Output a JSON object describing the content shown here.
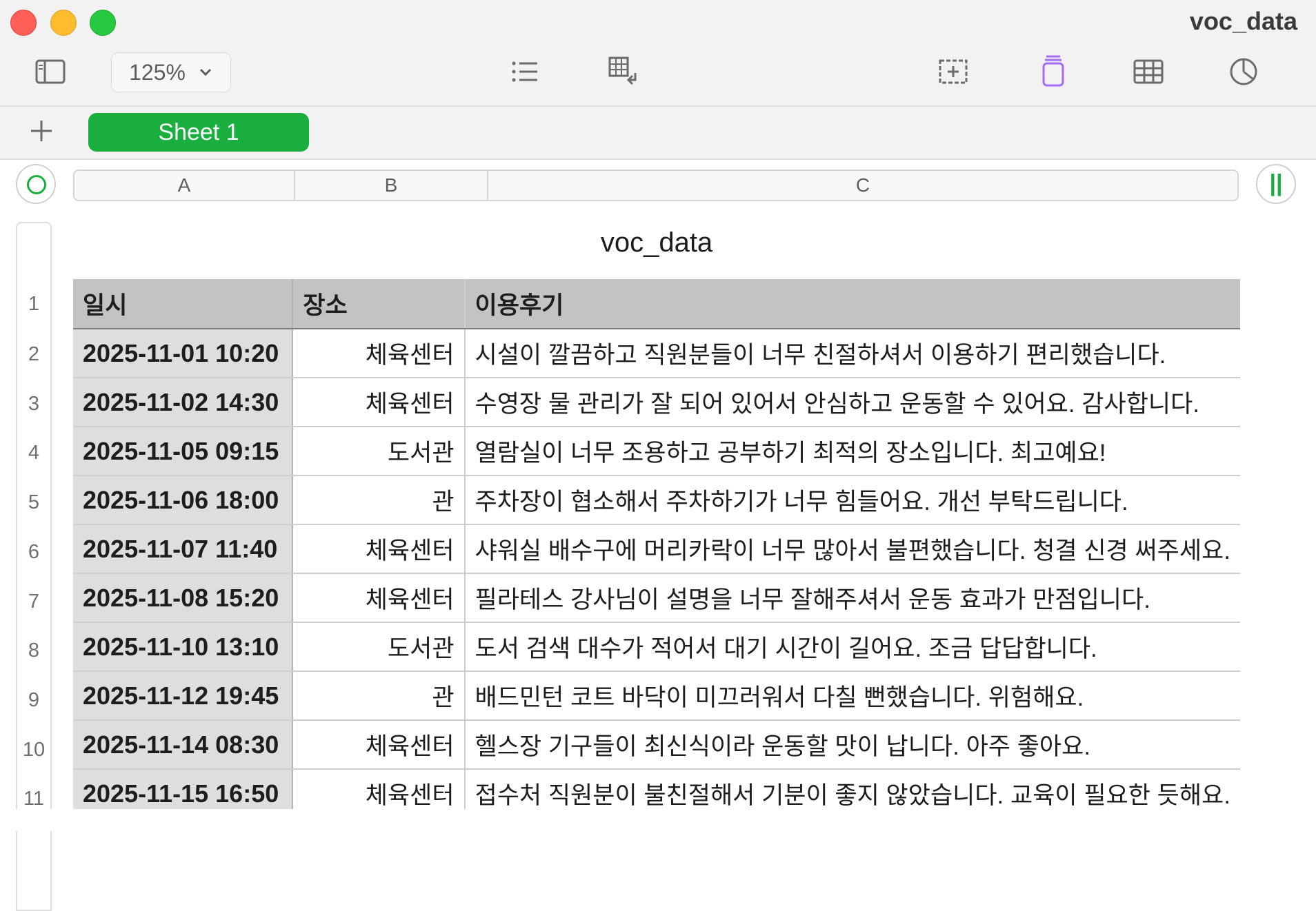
{
  "window": {
    "title": "voc_data"
  },
  "toolbar": {
    "zoom": "125%",
    "icons": [
      "sidebar-icon",
      "list-icon",
      "table-arrange-icon",
      "insert-shape-icon",
      "text-box-icon",
      "table-icon",
      "chart-icon"
    ]
  },
  "tabs": {
    "sheet1": "Sheet 1"
  },
  "columns": [
    "A",
    "B",
    "C"
  ],
  "table": {
    "title": "voc_data",
    "headers": [
      "일시",
      "장소",
      "이용후기"
    ],
    "rows": [
      {
        "num": "2",
        "a": "2025-11-01 10:20",
        "b": "체육센터",
        "c": "시설이 깔끔하고 직원분들이 너무 친절하셔서 이용하기 편리했습니다."
      },
      {
        "num": "3",
        "a": "2025-11-02 14:30",
        "b": "체육센터",
        "c": "수영장 물 관리가 잘 되어 있어서 안심하고 운동할 수 있어요. 감사합니다."
      },
      {
        "num": "4",
        "a": "2025-11-05 09:15",
        "b": "도서관",
        "c": "열람실이 너무 조용하고 공부하기 최적의 장소입니다. 최고예요!"
      },
      {
        "num": "5",
        "a": "2025-11-06 18:00",
        "b": "관",
        "c": "주차장이 협소해서 주차하기가 너무 힘들어요. 개선 부탁드립니다."
      },
      {
        "num": "6",
        "a": "2025-11-07 11:40",
        "b": "체육센터",
        "c": "샤워실 배수구에 머리카락이 너무 많아서 불편했습니다. 청결 신경 써주세요."
      },
      {
        "num": "7",
        "a": "2025-11-08 15:20",
        "b": "체육센터",
        "c": "필라테스 강사님이 설명을 너무 잘해주셔서 운동 효과가 만점입니다."
      },
      {
        "num": "8",
        "a": "2025-11-10 13:10",
        "b": "도서관",
        "c": "도서 검색 대수가 적어서 대기 시간이 길어요. 조금 답답합니다."
      },
      {
        "num": "9",
        "a": "2025-11-12 19:45",
        "b": "관",
        "c": "배드민턴 코트 바닥이 미끄러워서 다칠 뻔했습니다. 위험해요."
      },
      {
        "num": "10",
        "a": "2025-11-14 08:30",
        "b": "체육센터",
        "c": "헬스장 기구들이 최신식이라 운동할 맛이 납니다. 아주 좋아요."
      },
      {
        "num": "11",
        "a": "2025-11-15 16:50",
        "b": "체육센터",
        "c": "접수처 직원분이 불친절해서 기분이 좋지 않았습니다. 교육이 필요한 듯해요."
      }
    ]
  },
  "row_header_top": "1",
  "colors": {
    "accent": "#1aae3f",
    "header_fill": "#c3c3c3",
    "first_col_fill": "#dedede"
  }
}
